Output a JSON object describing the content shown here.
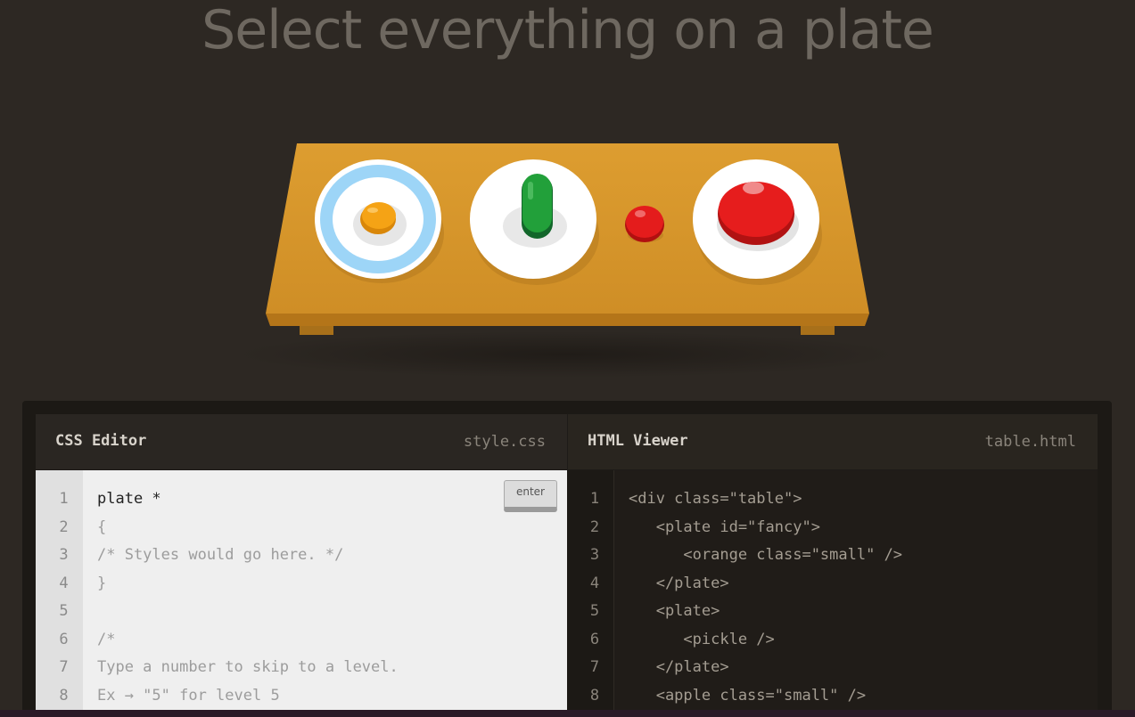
{
  "level": {
    "instruction": "Select everything on a plate"
  },
  "colors": {
    "background": "#2d2823",
    "table": "#d79a2c",
    "table_front": "#b97b1d",
    "plate": "#ffffff",
    "fancy_plate_ring": "#9fd6f5",
    "orange": "#f5a315",
    "pickle": "#21a039",
    "apple": "#e61d1d"
  },
  "scene": {
    "objects": [
      {
        "name": "fancy-plate",
        "items": [
          "orange-small"
        ]
      },
      {
        "name": "plate",
        "items": [
          "pickle"
        ]
      },
      {
        "name": "apple-small",
        "items": []
      },
      {
        "name": "plate",
        "items": [
          "apple"
        ]
      }
    ]
  },
  "css_editor": {
    "title": "CSS Editor",
    "filename": "style.css",
    "input_value": "plate *",
    "enter_label": "enter",
    "line_numbers": [
      "1",
      "2",
      "3",
      "4",
      "5",
      "6",
      "7",
      "8"
    ],
    "lines": [
      "{",
      "/* Styles would go here. */",
      "}",
      "",
      "/*",
      "Type a number to skip to a level.",
      "Ex → \"5\" for level 5"
    ]
  },
  "html_viewer": {
    "title": "HTML Viewer",
    "filename": "table.html",
    "line_numbers": [
      "1",
      "2",
      "3",
      "4",
      "5",
      "6",
      "7",
      "8"
    ],
    "lines": [
      "<div class=\"table\">",
      "   <plate id=\"fancy\">",
      "      <orange class=\"small\" />",
      "   </plate>",
      "   <plate>",
      "      <pickle />",
      "   </plate>",
      "   <apple class=\"small\" />"
    ]
  }
}
